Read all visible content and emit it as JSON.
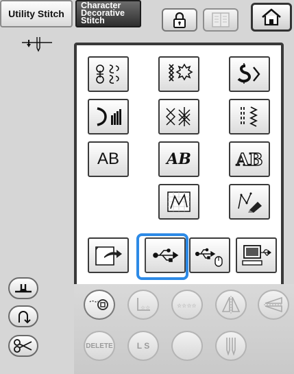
{
  "tabs": {
    "utility_label": "Utility Stitch",
    "character_lines": [
      "Character",
      "Decorative",
      "Stitch"
    ]
  },
  "icons": {
    "lock": "lock-icon",
    "pattern_book": "pattern-book-icon",
    "home": "home-icon",
    "needle": "needle-position-icon"
  },
  "stitch_grid": {
    "row1": [
      "decorative-pattern-icon",
      "floral-cross-icon",
      "satin-stitch-icon"
    ],
    "row2": [
      "gradient-satin-icon",
      "cross-stitch-icon",
      "zigzag-lines-icon"
    ],
    "row3": [
      {
        "label": "AB",
        "style": "block"
      },
      {
        "label": "AB",
        "style": "script"
      },
      {
        "label": "AB",
        "style": "outline"
      }
    ],
    "row4": [
      "my-custom-stitch-icon",
      "my-design-center-icon"
    ],
    "row5": [
      "machine-memory-icon",
      "usb-icon",
      "usb-mouse-icon",
      "computer-icon"
    ]
  },
  "selected": "usb",
  "side_buttons": [
    "presser-foot-icon",
    "reverse-stitch-icon",
    "scissors-icon"
  ],
  "edit_buttons": {
    "delete_label": "DELETE",
    "ls_label": "L S",
    "items": [
      "thread-icon",
      "size-icon",
      "density-icon",
      "mirror-icon",
      "flip-icon",
      "delete",
      "ls",
      "blank",
      "twin-needle-icon"
    ]
  },
  "accent_color": "#2d8ae6"
}
